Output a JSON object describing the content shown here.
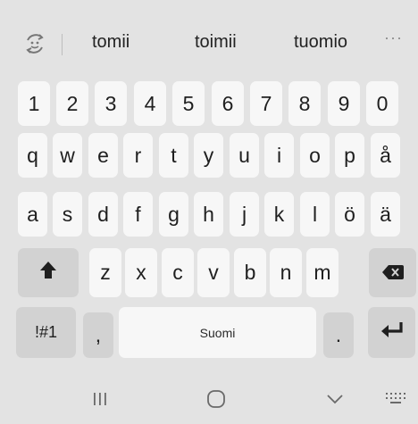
{
  "suggestions": {
    "icon": "emoji-refresh-icon",
    "words": [
      "tomii",
      "toimii",
      "tuomio"
    ],
    "more_label": "···"
  },
  "rows": {
    "numbers": [
      "1",
      "2",
      "3",
      "4",
      "5",
      "6",
      "7",
      "8",
      "9",
      "0"
    ],
    "row1": [
      "q",
      "w",
      "e",
      "r",
      "t",
      "y",
      "u",
      "i",
      "o",
      "p",
      "å"
    ],
    "row2": [
      "a",
      "s",
      "d",
      "f",
      "g",
      "h",
      "j",
      "k",
      "l",
      "ö",
      "ä"
    ],
    "row3": [
      "z",
      "x",
      "c",
      "v",
      "b",
      "n",
      "m"
    ]
  },
  "bottom": {
    "symbols_label": "!#1",
    "comma_label": ",",
    "space_label": "Suomi",
    "period_label": "."
  },
  "icons": {
    "shift": "shift-arrow-icon",
    "backspace": "backspace-icon",
    "enter": "enter-return-icon",
    "recent_apps": "recent-apps-icon",
    "home": "home-icon",
    "back": "back-chevron-icon",
    "keyboard_switch": "keyboard-grid-icon"
  },
  "colors": {
    "background": "#e3e3e3",
    "key": "#f7f7f7",
    "function_key": "#d2d2d2",
    "text": "#1f1f1f"
  }
}
